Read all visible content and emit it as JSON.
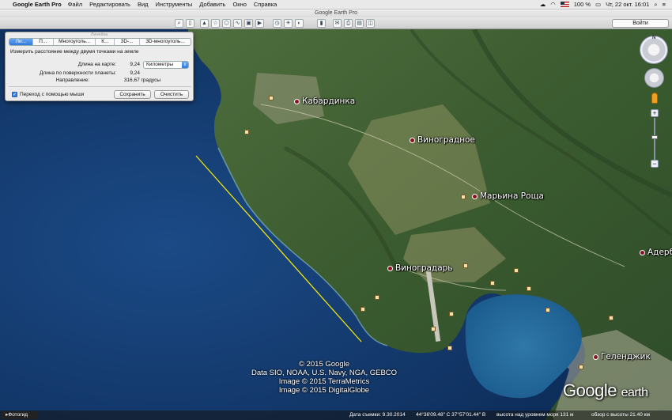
{
  "menubar": {
    "app_name": "Google Earth Pro",
    "items": [
      "Файл",
      "Редактировать",
      "Вид",
      "Инструменты",
      "Добавить",
      "Окно",
      "Справка"
    ],
    "battery": "100 %",
    "clock": "Чт, 22 окт. 16:01"
  },
  "window": {
    "title": "Google Earth Pro",
    "sign_in": "Войти"
  },
  "ruler": {
    "title": "Линейка",
    "tabs": [
      "Ли...",
      "П...",
      "Многоуголь...",
      "К...",
      "3D-...",
      "3D-многоуголь..."
    ],
    "description": "Измерить расстояние между двумя точками на земле",
    "map_length_label": "Длина на карте:",
    "map_length_value": "9,24",
    "unit": "Километры",
    "ground_length_label": "Длина по поверхности планеты:",
    "ground_length_value": "9,24",
    "heading_label": "Направление:",
    "heading_value": "316,67 градусы",
    "mouse_nav_label": "Переход с помощью мыши",
    "mouse_nav_checked": true,
    "save_label": "Сохранить",
    "clear_label": "Очистить"
  },
  "places": {
    "kabardinka": "Кабардинка",
    "vinogradnoe": "Виноградное",
    "marina_roscha": "Марьина Роща",
    "vinogradar": "Виноградарь",
    "gelendzhik": "Геленджик",
    "aderbiyevka": "Адерб"
  },
  "credits": [
    "© 2015 Google",
    "Data SIO, NOAA, U.S. Navy, NGA, GEBCO",
    "Image © 2015 TerraMetrics",
    "Image © 2015 DigitalGlobe"
  ],
  "logo": {
    "main": "Google",
    "suffix": "earth"
  },
  "nav": {
    "north": "N"
  },
  "status": {
    "photo_tour": "Фотогид",
    "date_label": "Дата съемки: 9.30.2014",
    "coordinates": "44°36'09.48\" С  37°57'01.44\" В",
    "elevation": "высота над уровнем моря  131 м",
    "eye_altitude": "обзор с высоты  21.40 км"
  },
  "colors": {
    "sea": "#123c70",
    "land": "#3d5b32",
    "measure_line": "#ffee00",
    "marker": "#8b1020"
  }
}
